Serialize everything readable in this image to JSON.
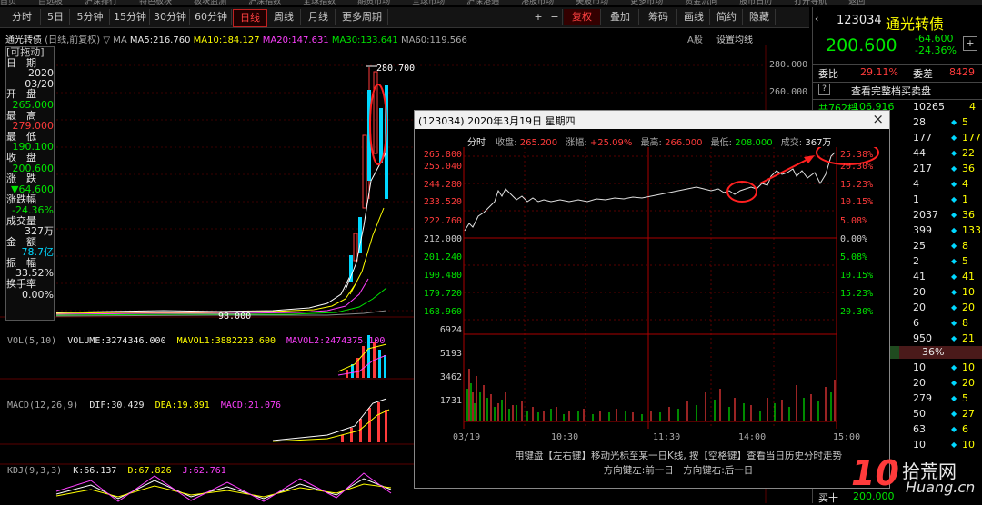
{
  "menu": [
    "首页",
    "自选股",
    "沪深排行",
    "特色板块",
    "板块监测",
    "沪深指数",
    "全球指数",
    "期货市场",
    "全球市场",
    "沪深港通",
    "港股市场",
    "美股市场",
    "更多市场",
    "资金流向",
    "股市日历",
    "打开导航",
    "返回"
  ],
  "toolbar": {
    "periods": [
      "分时",
      "5日",
      "5分钟",
      "15分钟",
      "30分钟",
      "60分钟",
      "日线",
      "周线",
      "月线",
      "更多周期"
    ],
    "active": "日线",
    "right": [
      "+",
      "−",
      "复权",
      "叠加",
      "筹码",
      "画线",
      "简约",
      "隐藏"
    ]
  },
  "ma_line": {
    "title": "通光转债",
    "sub": "(日线,前复权)",
    "ma5": "MA5:216.760",
    "ma10": "MA10:184.127",
    "ma20": "MA20:147.631",
    "ma30": "MA30:133.641",
    "ma60": "MA60:119.566",
    "ashare": "A股",
    "settings": "设置均线"
  },
  "price_axis": [
    "280.000",
    "260.000"
  ],
  "high_label": "280.700",
  "low_label": "98.000",
  "info": {
    "drag": "[可拖动]",
    "date_l": "日　期",
    "year": "2020",
    "date": "03/20",
    "open_l": "开　盘",
    "open": "265.000",
    "high_l": "最　高",
    "high": "279.000",
    "low_l": "最　低",
    "low": "190.100",
    "close_l": "收　盘",
    "close": "200.600",
    "chg_l": "涨　跌",
    "chg": "▼64.600",
    "pct_l": "涨跌幅",
    "pct": "-24.36%",
    "vol_l": "成交量",
    "vol": "327万",
    "amt_l": "金　额",
    "amt": "78.7亿",
    "amp_l": "振　幅",
    "amp": "33.52%",
    "turn_l": "换手率",
    "turn": "0.00%"
  },
  "vol_bar": {
    "name": "VOL(5,10)",
    "volume": "VOLUME:3274346.000",
    "m1": "MAVOL1:3882223.600",
    "m2": "MAVOL2:2474375.100"
  },
  "macd_bar": {
    "name": "MACD(12,26,9)",
    "dif": "DIF:30.429",
    "dea": "DEA:19.891",
    "macd": "MACD:21.076"
  },
  "kdj_bar": {
    "name": "KDJ(9,3,3)",
    "k": "K:66.137",
    "d": "D:67.826",
    "j": "J:62.761"
  },
  "quote": {
    "code": "123034",
    "name": "通光转债",
    "price": "200.600",
    "change": "-64.600",
    "pct": "-24.36%",
    "weibi_l": "委比",
    "weibi": "29.11%",
    "weicha_l": "委差",
    "weicha": "8429",
    "full_book": "查看完整档买卖盘",
    "sell1": "共762档",
    "sell1_price": "106.916",
    "sell1_vol": "10265",
    "sell1_n": "4",
    "rows": [
      {
        "v": "28",
        "f": "5"
      },
      {
        "v": "177",
        "f": "177"
      },
      {
        "v": "44",
        "f": "22"
      },
      {
        "v": "217",
        "f": "36"
      },
      {
        "v": "4",
        "f": "4"
      },
      {
        "v": "1",
        "f": "1"
      },
      {
        "v": "2037",
        "f": "36"
      },
      {
        "v": "399",
        "f": "133"
      },
      {
        "v": "25",
        "f": "8"
      },
      {
        "v": "2",
        "f": "5"
      },
      {
        "v": "41",
        "f": "41"
      },
      {
        "v": "20",
        "f": "10"
      },
      {
        "v": "20",
        "f": "20"
      },
      {
        "v": "6",
        "f": "8"
      },
      {
        "v": "950",
        "f": "21"
      }
    ],
    "ratio": "36%",
    "lower": [
      {
        "v": "10",
        "f": "10"
      },
      {
        "v": "20",
        "f": "20"
      },
      {
        "v": "279",
        "f": "5"
      },
      {
        "v": "50",
        "f": "27"
      },
      {
        "v": "63",
        "f": "6"
      },
      {
        "v": "10",
        "f": "10"
      }
    ],
    "buy10_l": "买十",
    "buy10": "200.000"
  },
  "popup": {
    "title": "(123034) 2020年3月19日 星期四",
    "tag": "分时",
    "close_l": "收盘:",
    "close": "265.200",
    "chg_l": "涨幅:",
    "chg": "+25.09%",
    "high_l": "最高:",
    "high": "266.000",
    "low_l": "最低:",
    "low": "208.000",
    "vol_l": "成交:",
    "vol": "367万",
    "left_axis": [
      "265.800",
      "255.040",
      "244.280",
      "233.520",
      "222.760",
      "212.000",
      "201.240",
      "190.480",
      "179.720",
      "168.960"
    ],
    "right_axis": [
      "25.38%",
      "20.30%",
      "15.23%",
      "10.15%",
      "5.08%",
      "0.00%",
      "5.08%",
      "10.15%",
      "15.23%",
      "20.30%"
    ],
    "vol_axis": [
      "6924",
      "5193",
      "3462",
      "1731"
    ],
    "time_axis": [
      "03/19",
      "10:30",
      "11:30",
      "14:00",
      "15:00"
    ],
    "hint1": "用键盘【左右键】移动光标至某一日K线, 按【空格键】查看当日历史分时走势",
    "hint2": "方向键左:前一日　方向键右:后一日"
  },
  "watermark": {
    "num": "10",
    "text": "拾荒网",
    "url": "Huang.cn"
  },
  "colors": {
    "up": "#ff3b3b",
    "down": "#00e600",
    "accent": "#00d8ff",
    "bg": "#000000"
  }
}
